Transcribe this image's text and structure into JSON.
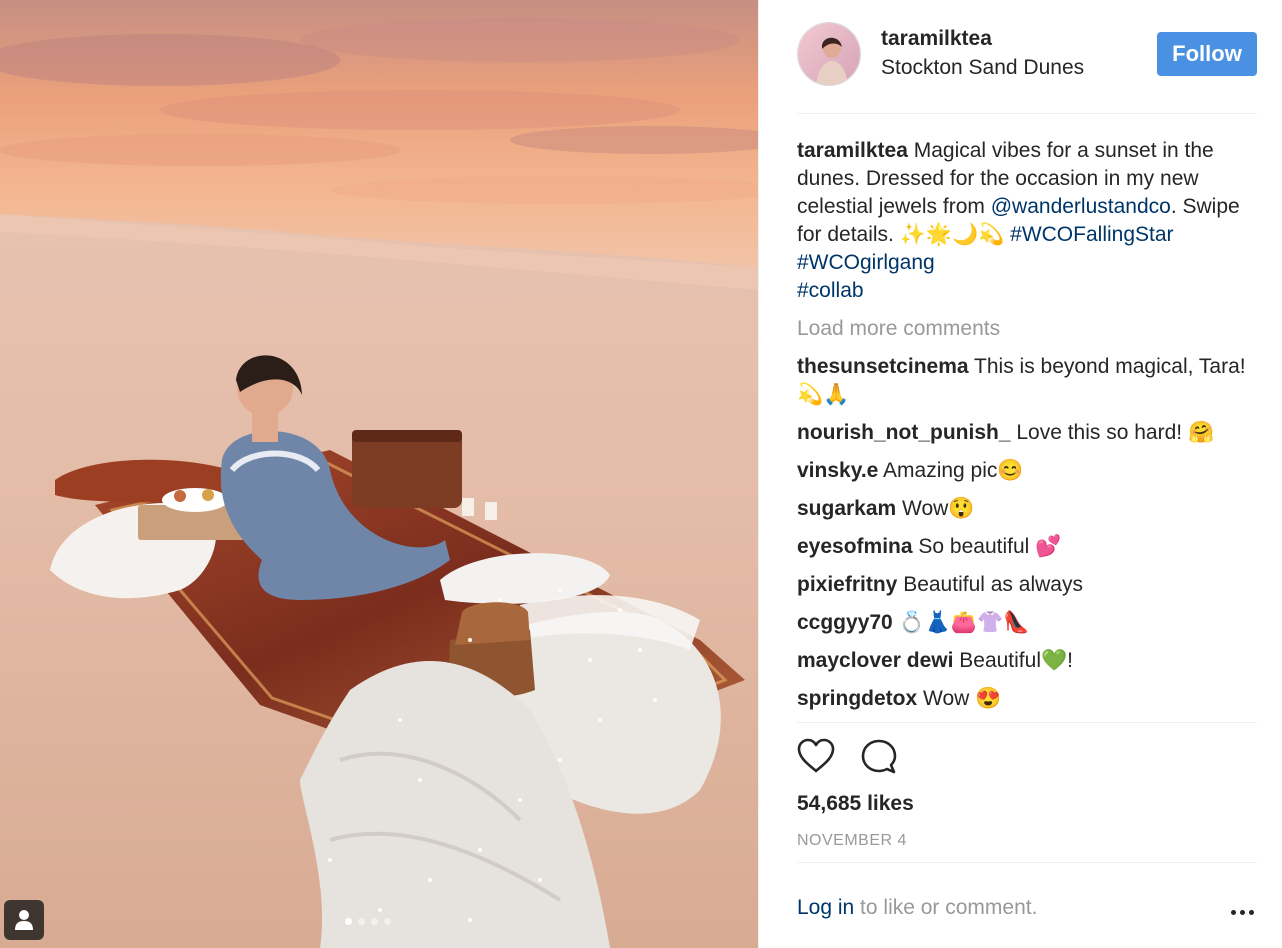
{
  "post": {
    "username": "taramilktea",
    "location": "Stockton Sand Dunes",
    "follow_label": "Follow",
    "caption": {
      "username": "taramilktea",
      "text_1": " Magical vibes for a sunset in the dunes. Dressed for the occasion in my new celestial jewels from ",
      "mention": "@wanderlustandco",
      "text_2": ". Swipe for details. ✨🌟🌙💫 ",
      "hashtag_1": "#WCOFallingStar",
      "space": " ",
      "hashtag_2": "#WCOgirlgang",
      "hashtag_3": "#collab"
    },
    "load_more": "Load more comments",
    "comments": [
      {
        "user": "thesunsetcinema",
        "text": " This is beyond magical, Tara! 💫🙏"
      },
      {
        "user": "nourish_not_punish_",
        "text": " Love this so hard! 🤗"
      },
      {
        "user": "vinsky.e",
        "text": " Amazing pic😊"
      },
      {
        "user": "sugarkam",
        "text": " Wow😲"
      },
      {
        "user": "eyesofmina",
        "text": " So beautiful 💕"
      },
      {
        "user": "pixiefritny",
        "text": " Beautiful as always"
      },
      {
        "user": "ccggyy70",
        "text": " 💍👗👛👚👠"
      },
      {
        "user": "mayclover dewi",
        "text": " Beautiful💚!"
      },
      {
        "user": "springdetox",
        "text": " Wow 😍"
      }
    ],
    "likes": "54,685 likes",
    "date": "NOVEMBER 4",
    "login_link": "Log in",
    "login_rest": " to like or comment.",
    "carousel": {
      "count": 4,
      "active": 1
    }
  },
  "icons": {
    "like": "heart-icon",
    "comment": "comment-icon",
    "more": "more-options-icon",
    "user_tags": "user-tag-icon"
  },
  "colors": {
    "follow_bg": "#4b91e3",
    "link": "#003569",
    "muted": "#999999"
  }
}
